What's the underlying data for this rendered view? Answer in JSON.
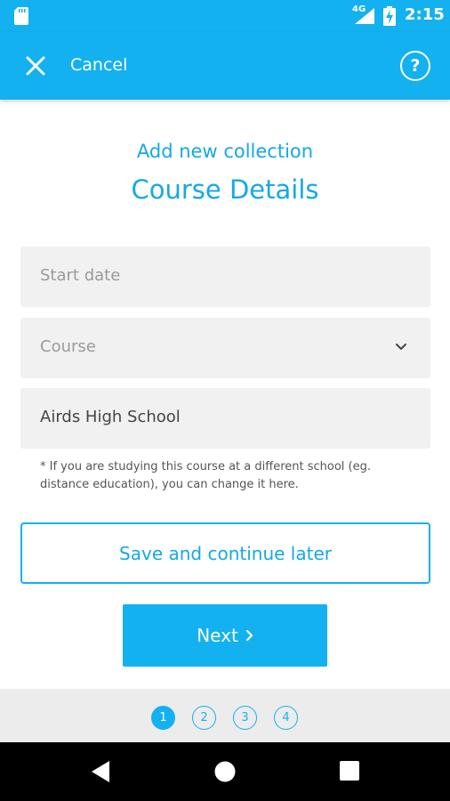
{
  "status_bar": {
    "network": "4G",
    "time": "2:15",
    "icons": [
      "sd-card-icon",
      "signal-icon",
      "battery-charging-icon"
    ]
  },
  "app_bar": {
    "cancel_label": "Cancel",
    "help_label": "?",
    "icons": [
      "close-icon",
      "help-icon"
    ]
  },
  "header": {
    "subtitle": "Add new collection",
    "title": "Course Details"
  },
  "form": {
    "start_date": {
      "placeholder": "Start date",
      "value": ""
    },
    "course": {
      "placeholder": "Course",
      "selected": "",
      "icon": "chevron-down-icon"
    },
    "school": {
      "value": "Airds High School"
    },
    "note": "* If you are studying this course at a different school (eg. distance education), you can change it here."
  },
  "actions": {
    "save_label": "Save and continue later",
    "next_label": "Next"
  },
  "stepper": {
    "steps": [
      "1",
      "2",
      "3",
      "4"
    ],
    "current": 1
  },
  "colors": {
    "accent": "#13b1ef",
    "field_bg": "#f1f1f1",
    "stepper_bg": "#ececec"
  }
}
